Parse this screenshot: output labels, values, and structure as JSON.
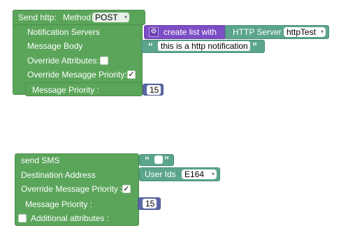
{
  "block1": {
    "title": "Send http:",
    "method_label": "Method",
    "method_value": "POST",
    "rows": [
      "Notification Servers",
      "Message Body",
      "Override Attributes:",
      "Override Mesagge Priority:",
      "Message Priority :"
    ],
    "create_list_label": "create list with",
    "server_label": "HTTP Server",
    "server_value": "httpTest",
    "body_text": "this is a http notification",
    "priority_checked_mark": "✓",
    "priority_value": "15"
  },
  "block2": {
    "title": "send SMS",
    "rows": [
      "Destination Address",
      "Override Message Priority :",
      "Message Priority :",
      "Additional attributes :"
    ],
    "user_ids_label": "User Ids",
    "user_ids_format": "E164",
    "priority_checked_mark": "✓",
    "priority_value": "15"
  },
  "icons": {
    "dropdown_arrow": "▾",
    "open_quote": "“",
    "close_quote": "”",
    "gear": "⚙"
  }
}
